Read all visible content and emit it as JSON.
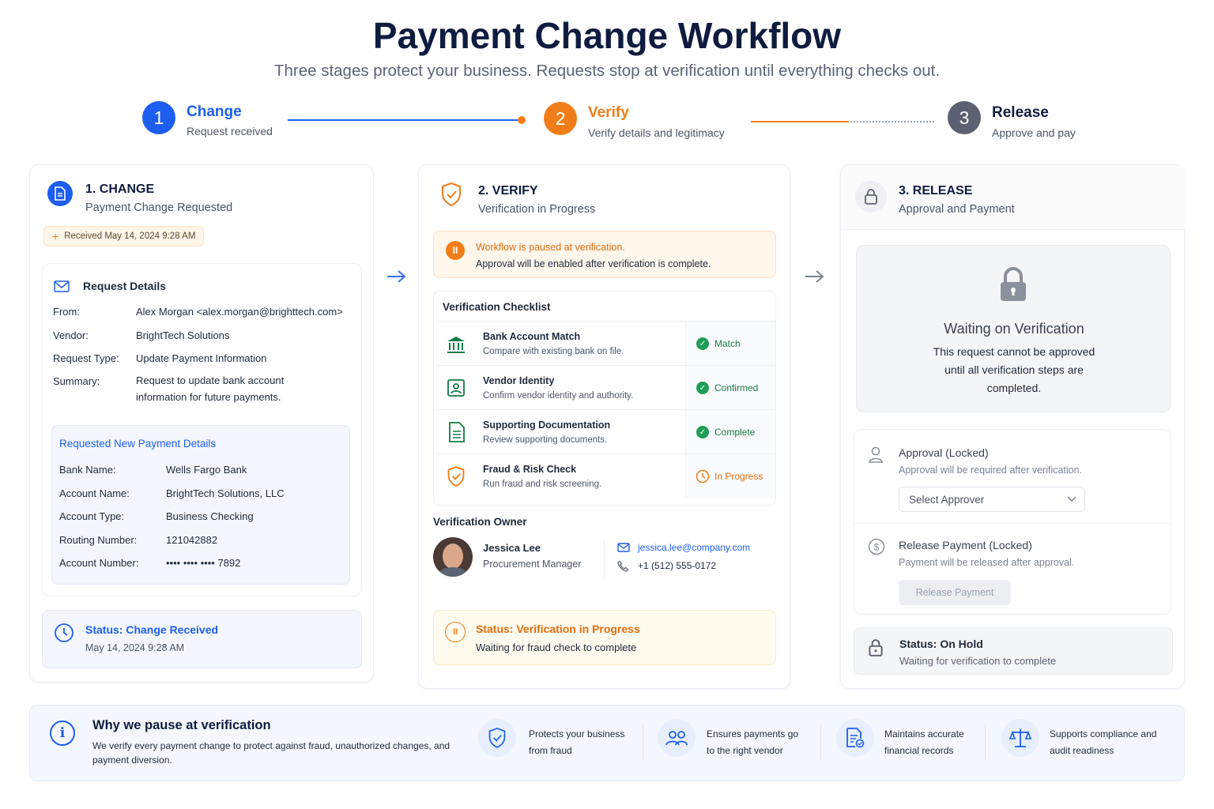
{
  "header": {
    "title": "Payment Change Workflow",
    "subtitle": "Three stages protect your business. Requests stop at verification until everything checks out."
  },
  "steps": [
    {
      "num": "1",
      "name": "Change",
      "sub": "Request received",
      "color": "#1d5ef0"
    },
    {
      "num": "2",
      "name": "Verify",
      "sub": "Verify details and legitimacy",
      "color": "#f07d18"
    },
    {
      "num": "3",
      "name": "Release",
      "sub": "Approve and pay",
      "color": "#5b6170"
    }
  ],
  "change": {
    "title": "1. CHANGE",
    "subtitle": "Payment Change Requested",
    "received": "Received May 14, 2024 9:28 AM",
    "details_title": "Request Details",
    "details": [
      {
        "label": "From:",
        "value": "Alex Morgan <alex.morgan@brighttech.com>"
      },
      {
        "label": "Vendor:",
        "value": "BrightTech Solutions"
      },
      {
        "label": "Request Type:",
        "value": "Update Payment Information"
      },
      {
        "label": "Summary:",
        "value": "Request to update bank account information for future payments."
      }
    ],
    "payment_title": "Requested New Payment Details",
    "payment": [
      {
        "label": "Bank Name:",
        "value": "Wells Fargo Bank"
      },
      {
        "label": "Account Name:",
        "value": "BrightTech Solutions, LLC"
      },
      {
        "label": "Account Type:",
        "value": "Business Checking"
      },
      {
        "label": "Routing Number:",
        "value": "121042882"
      },
      {
        "label": "Account Number:",
        "value": "•••• •••• •••• 7892"
      }
    ],
    "status_title": "Status: Change Received",
    "status_time": "May 14, 2024 9:28 AM"
  },
  "verify": {
    "title": "2. VERIFY",
    "subtitle": "Verification in Progress",
    "paused_title": "Workflow is paused at verification.",
    "paused_sub": "Approval will be enabled after verification is complete.",
    "checklist_title": "Verification Checklist",
    "checklist": [
      {
        "title": "Bank Account Match",
        "sub": "Compare with existing bank on file.",
        "status": "Match",
        "icon": "bank-icon",
        "state": "done"
      },
      {
        "title": "Vendor Identity",
        "sub": "Confirm vendor identity and authority.",
        "status": "Confirmed",
        "icon": "id-card-icon",
        "state": "done"
      },
      {
        "title": "Supporting Documentation",
        "sub": "Review supporting documents.",
        "status": "Complete",
        "icon": "document-icon",
        "state": "done"
      },
      {
        "title": "Fraud & Risk Check",
        "sub": "Run fraud and risk screening.",
        "status": "In Progress",
        "icon": "shield-icon",
        "state": "progress"
      }
    ],
    "owner_title": "Verification Owner",
    "owner_name": "Jessica Lee",
    "owner_role": "Procurement Manager",
    "owner_email": "jessica.lee@company.com",
    "owner_phone": "+1 (512) 555-0172",
    "status_title": "Status: Verification in Progress",
    "status_sub": "Waiting for fraud check to complete"
  },
  "release": {
    "title": "3. RELEASE",
    "subtitle": "Approval and Payment",
    "waiting_title": "Waiting on Verification",
    "waiting_sub": "This request cannot be approved until all verification steps are completed.",
    "approval_title": "Approval (Locked)",
    "approval_sub": "Approval will be required after verification.",
    "approver_placeholder": "Select Approver",
    "pay_title": "Release Payment (Locked)",
    "pay_sub": "Payment will be released after approval.",
    "pay_button": "Release Payment",
    "status_title": "Status: On Hold",
    "status_sub": "Waiting for verification to complete"
  },
  "footer": {
    "title": "Why we pause at verification",
    "sub": "We verify every payment change to protect against fraud, unauthorized changes, and payment diversion.",
    "benefits": [
      {
        "text": "Protects your business from fraud",
        "icon": "shield-check-icon"
      },
      {
        "text": "Ensures payments go to the right vendor",
        "icon": "users-icon"
      },
      {
        "text": "Maintains accurate financial records",
        "icon": "records-icon"
      },
      {
        "text": "Supports compliance and audit readiness",
        "icon": "scale-icon"
      }
    ]
  },
  "colors": {
    "blue": "#1d5ef0",
    "orange": "#f07d18",
    "green": "#1e9e57",
    "gray": "#5b6170"
  }
}
